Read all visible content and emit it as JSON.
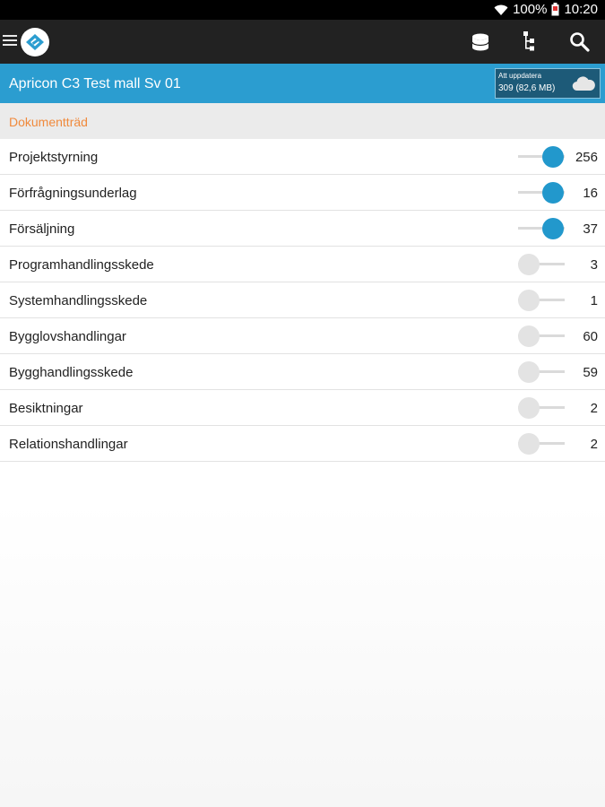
{
  "statusbar": {
    "battery": "100%",
    "time": "10:20",
    "icons": [
      "wifi-icon",
      "battery-icon"
    ]
  },
  "toolbar": {
    "icons": [
      "menu-icon",
      "app-logo",
      "database-icon",
      "tree-icon",
      "search-icon"
    ]
  },
  "project": {
    "title": "Apricon C3 Test mall Sv 01",
    "update_label": "Att uppdatera",
    "update_count": "309 (82,6 MB)",
    "icon": "cloud-icon"
  },
  "section": {
    "title": "Dokumentträd"
  },
  "items": [
    {
      "label": "Projektstyrning",
      "count": "256",
      "enabled": true
    },
    {
      "label": "Förfrågningsunderlag",
      "count": "16",
      "enabled": true
    },
    {
      "label": "Försäljning",
      "count": "37",
      "enabled": true
    },
    {
      "label": "Programhandlingsskede",
      "count": "3",
      "enabled": false
    },
    {
      "label": "Systemhandlingsskede",
      "count": "1",
      "enabled": false
    },
    {
      "label": "Bygglovshandlingar",
      "count": "60",
      "enabled": false
    },
    {
      "label": "Bygghandlingsskede",
      "count": "59",
      "enabled": false
    },
    {
      "label": "Besiktningar",
      "count": "2",
      "enabled": false
    },
    {
      "label": "Relationshandlingar",
      "count": "2",
      "enabled": false
    }
  ],
  "colors": {
    "accent": "#2b9dd0",
    "switch_on": "#2298cc",
    "section_title": "#f08a3c",
    "toolbar": "#222222"
  }
}
